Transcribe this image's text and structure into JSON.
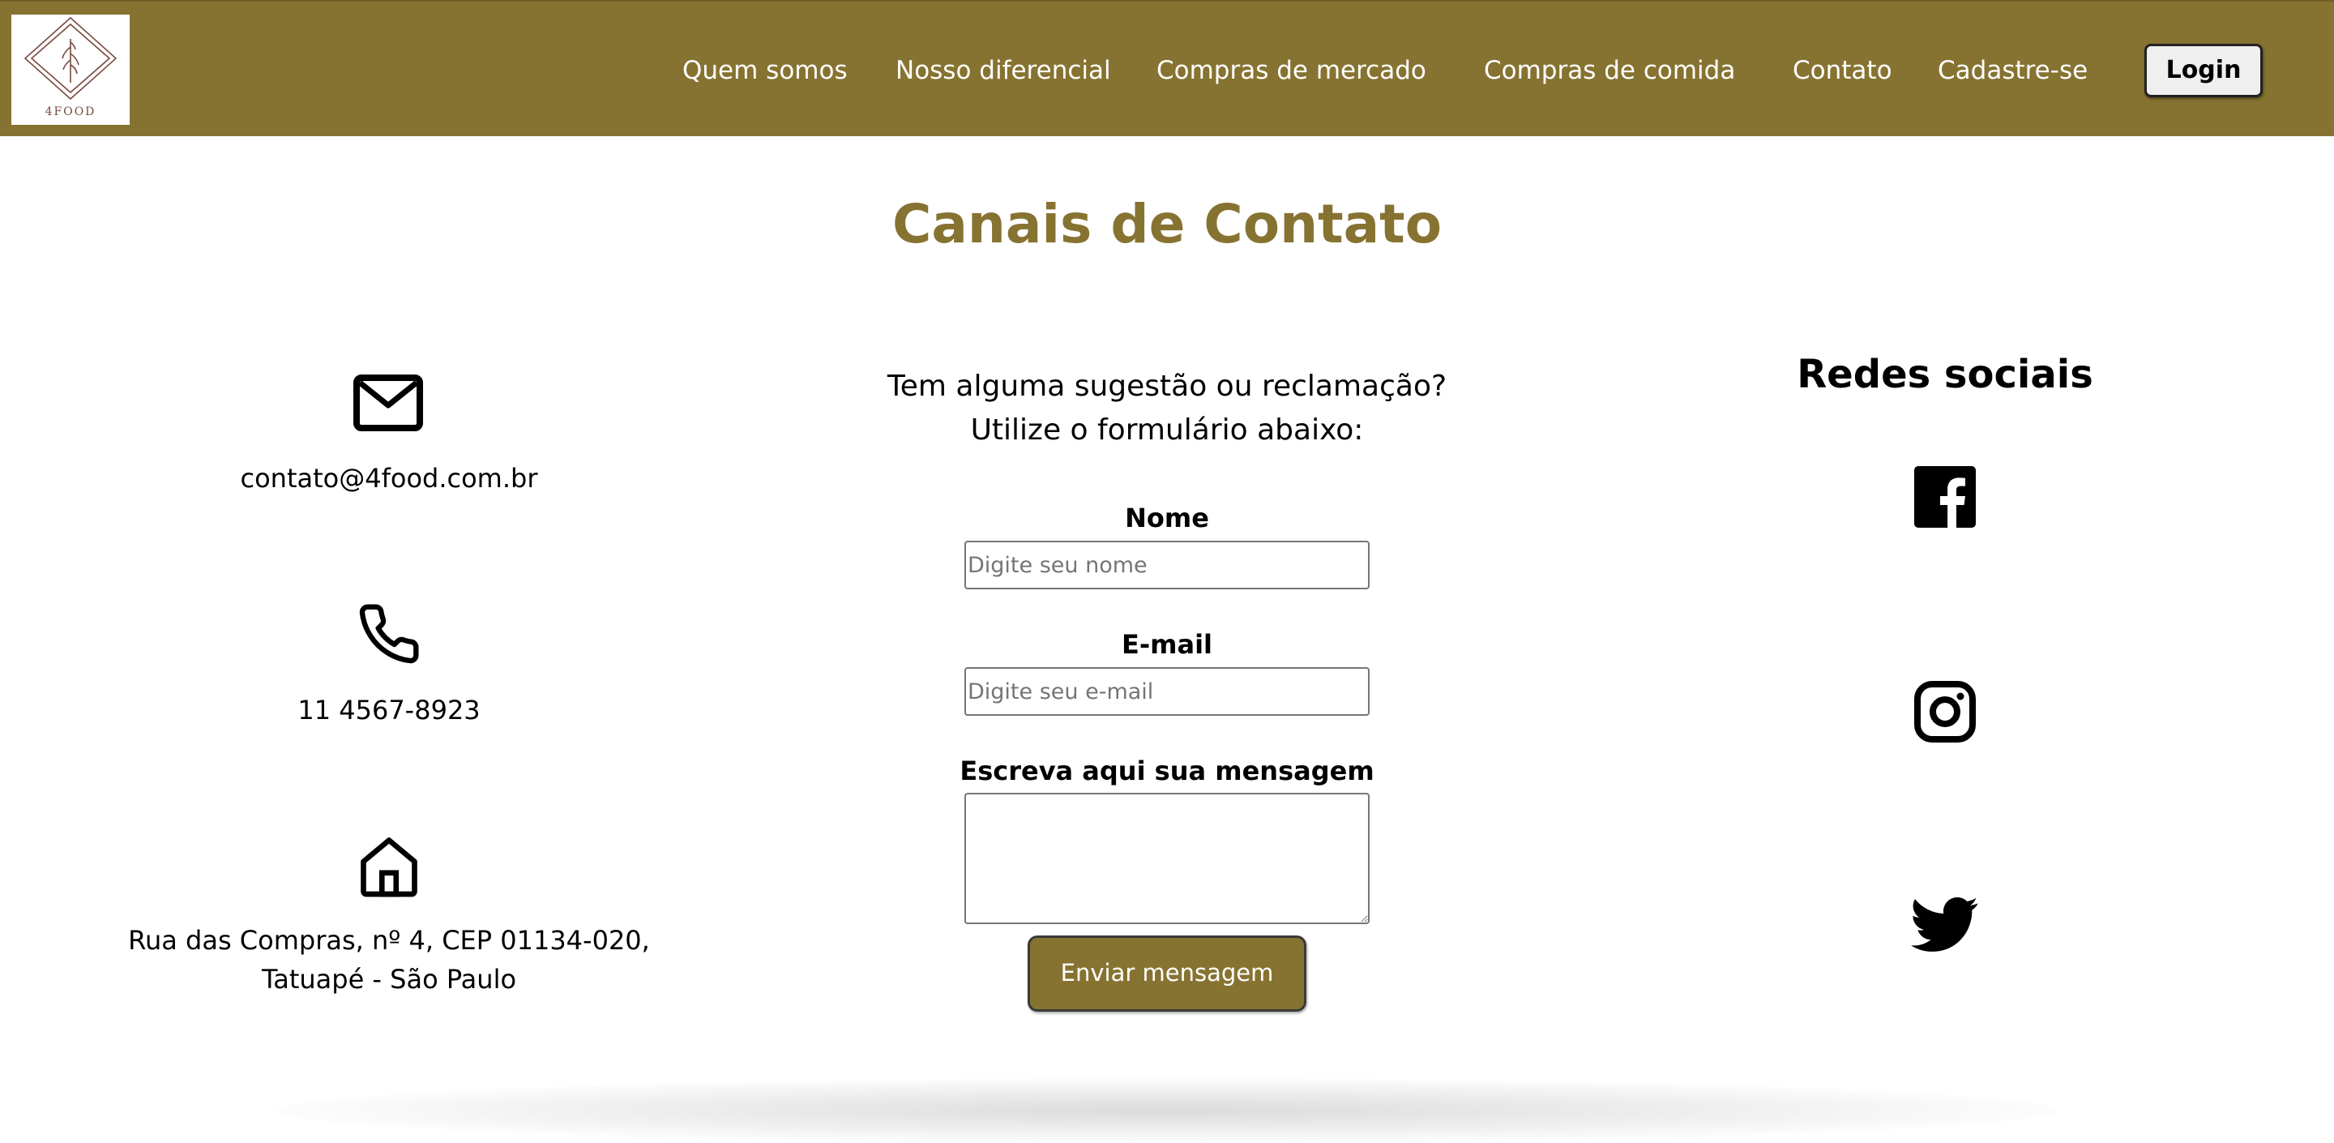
{
  "brand": {
    "logo_text": "4FOOD",
    "color": "#877331"
  },
  "nav": {
    "items": [
      "Quem somos",
      "Nosso diferencial",
      "Compras de mercado",
      "Compras de comida",
      "Contato",
      "Cadastre-se"
    ],
    "login_label": "Login"
  },
  "page": {
    "title": "Canais de Contato"
  },
  "contacts": {
    "email": {
      "icon": "envelope-icon",
      "text": "contato@4food.com.br"
    },
    "phone": {
      "icon": "phone-icon",
      "text": "11 4567-8923"
    },
    "address": {
      "icon": "house-icon",
      "line1": "Rua das Compras, nº 4, CEP 01134-020,",
      "line2": "Tatuapé - São Paulo"
    }
  },
  "form": {
    "intro_line1": "Tem alguma sugestão ou reclamação?",
    "intro_line2": "Utilize o formulário abaixo:",
    "name_label": "Nome",
    "name_placeholder": "Digite seu nome",
    "email_label": "E-mail",
    "email_placeholder": "Digite seu e-mail",
    "message_label": "Escreva aqui sua mensagem",
    "message_value": "",
    "submit_label": "Enviar mensagem"
  },
  "social": {
    "title": "Redes sociais",
    "icons": [
      "facebook-icon",
      "instagram-icon",
      "twitter-icon"
    ]
  }
}
